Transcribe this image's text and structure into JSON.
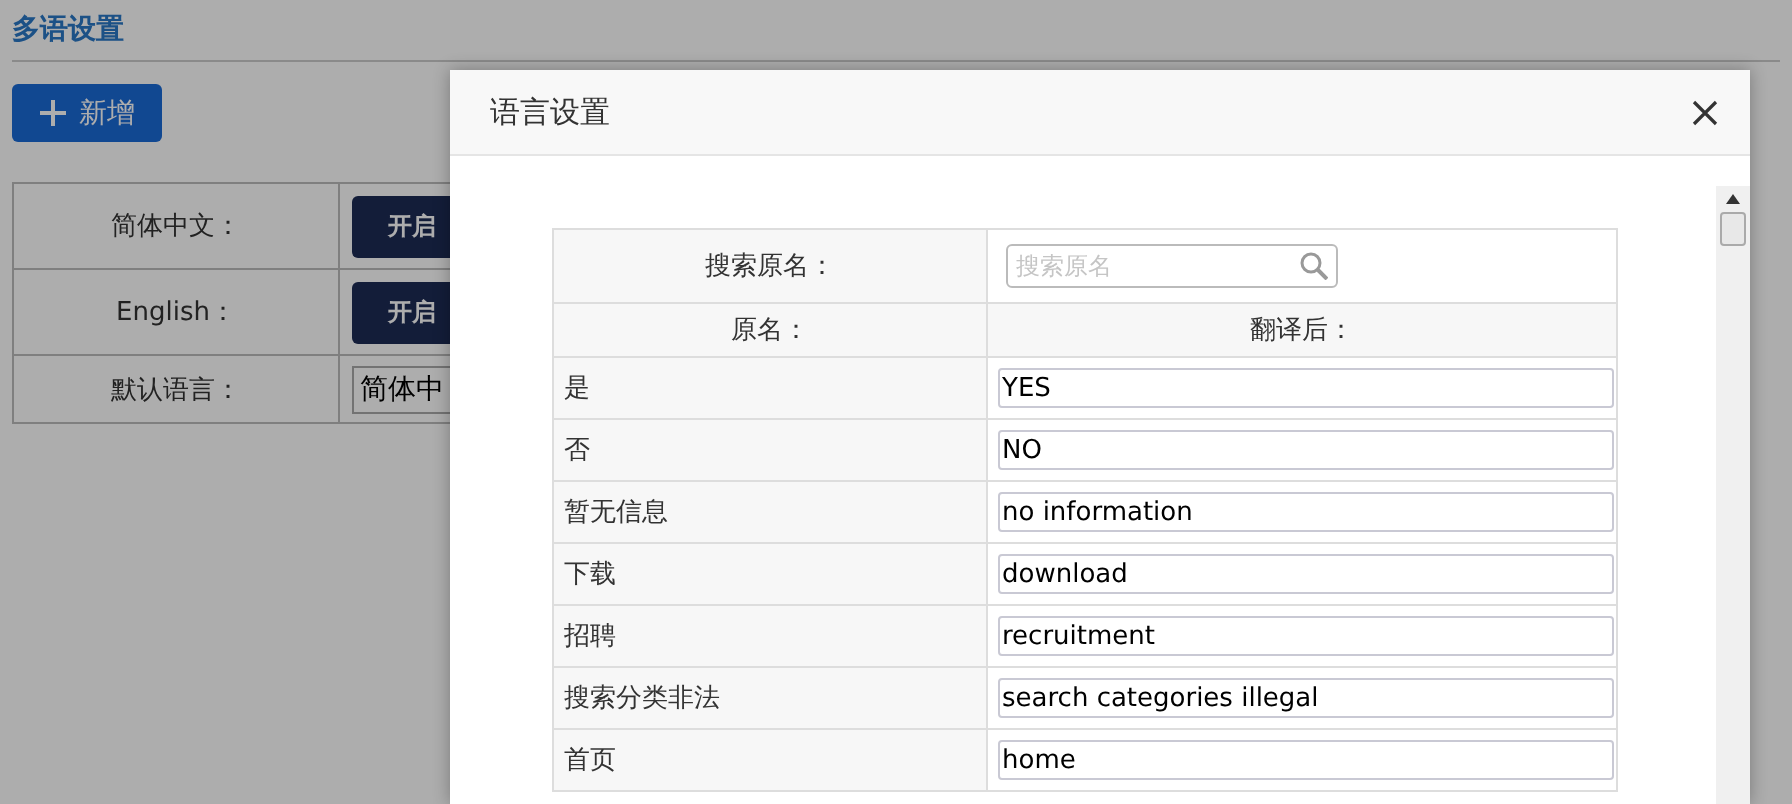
{
  "page": {
    "title": "多语设置",
    "add_button": "新增",
    "languages": [
      {
        "label": "简体中文：",
        "button": "开启"
      },
      {
        "label": "English：",
        "button": "开启"
      }
    ],
    "default_language": {
      "label": "默认语言：",
      "value": "简体中"
    }
  },
  "dialog": {
    "title": "语言设置",
    "search": {
      "label": "搜索原名：",
      "placeholder": "搜索原名"
    },
    "columns": [
      "原名：",
      "翻译后："
    ],
    "rows": [
      {
        "original": "是",
        "translation": "YES"
      },
      {
        "original": "否",
        "translation": "NO"
      },
      {
        "original": "暂无信息",
        "translation": "no information"
      },
      {
        "original": "下载",
        "translation": "download"
      },
      {
        "original": "招聘",
        "translation": "recruitment"
      },
      {
        "original": "搜索分类非法",
        "translation": "search categories illegal"
      },
      {
        "original": "首页",
        "translation": "home"
      }
    ]
  }
}
